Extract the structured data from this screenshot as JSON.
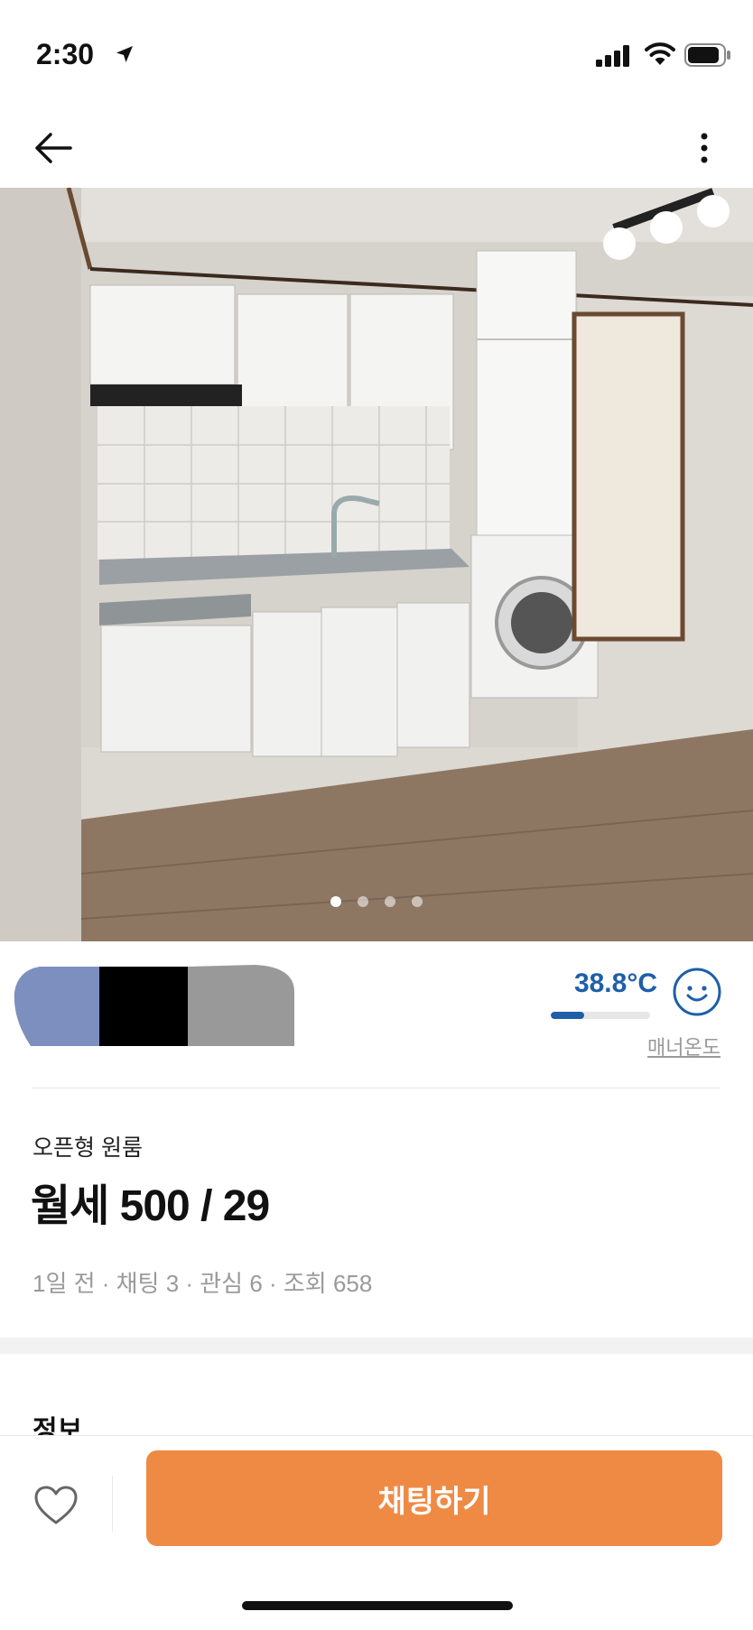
{
  "status_bar": {
    "time": "2:30"
  },
  "nav": {
    "back_icon": "arrow-left-icon",
    "more_icon": "vertical-ellipsis-icon"
  },
  "photo": {
    "subject": "kitchen",
    "page_count": 4,
    "active_page": 1
  },
  "seller": {
    "manner_temperature": "38.8°C",
    "temperature_fill_fraction": 0.34,
    "manner_label": "매너온도",
    "colors": {
      "temperature": "#1e5fa8"
    }
  },
  "listing": {
    "type": "오픈형 원룸",
    "price": "월세 500 / 29",
    "meta": "1일 전 · 채팅 3 · 관심 6 · 조회 658"
  },
  "info_section": {
    "heading": "정보"
  },
  "bottom_bar": {
    "chat_label": "채팅하기",
    "accent_color": "#ef8a45"
  }
}
